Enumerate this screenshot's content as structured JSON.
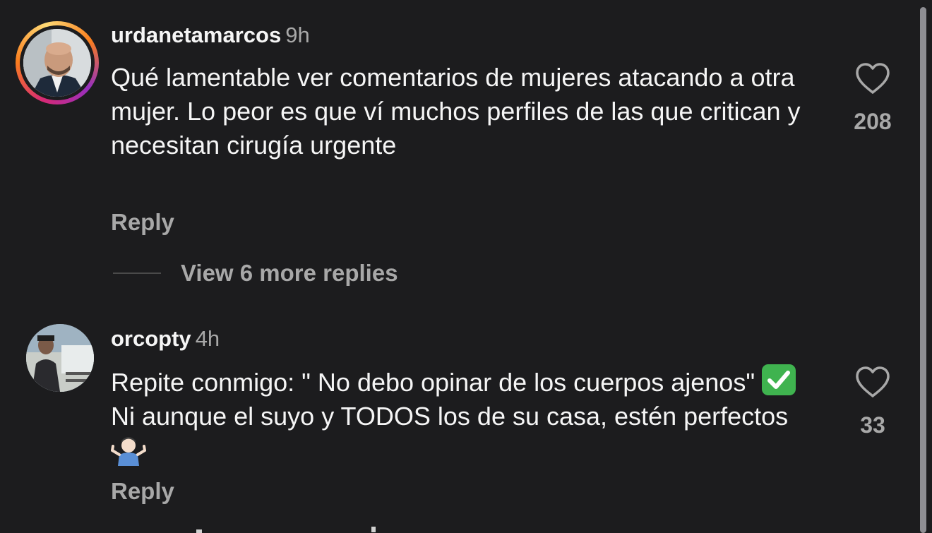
{
  "comments": [
    {
      "username": "urdanetamarcos",
      "time": "9h",
      "text": "Qué lamentable ver comentarios de mujeres atacando a otra mujer. Lo peor es que ví muchos perfiles de las que critican y necesitan cirugía urgente",
      "reply_label": "Reply",
      "likes": "208",
      "has_story_ring": true
    },
    {
      "username": "orcopty",
      "time": "4h",
      "text_part1": "Repite conmigo: \" No debo opinar de los cuerpos ajenos\"",
      "text_part2": "Ni aunque el suyo y TODOS los de su casa, estén perfectos",
      "reply_label": "Reply",
      "likes": "33",
      "has_story_ring": false
    }
  ],
  "view_replies_label": "View 6 more replies",
  "icons": {
    "like": "heart-outline-icon",
    "check_emoji": "check-mark-button-emoji",
    "shrug_emoji": "man-shrugging-emoji"
  },
  "colors": {
    "background": "#1c1c1e",
    "text": "#f5f5f5",
    "secondary": "#a8a8a8"
  }
}
